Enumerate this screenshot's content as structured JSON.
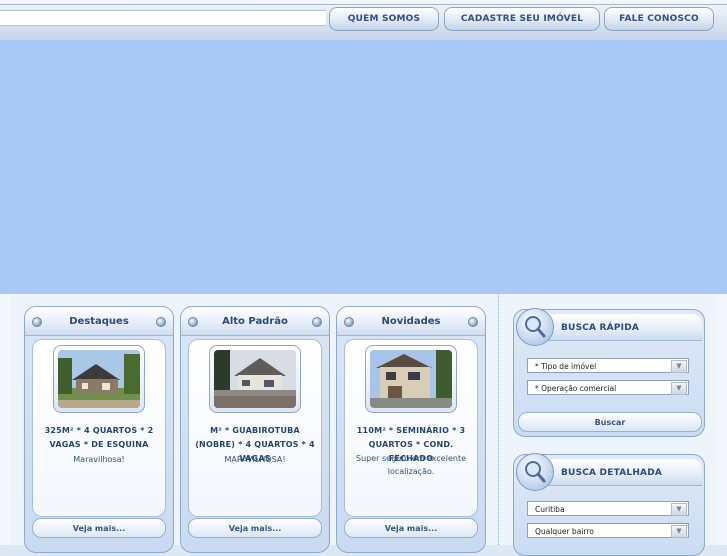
{
  "nav": {
    "about": "QUEM SOMOS",
    "register": "CADASTRE SEU IMÓVEL",
    "contact": "FALE CONOSCO"
  },
  "cards": [
    {
      "heading": "Destaques",
      "title": "325M² * 4 QUARTOS * 2 VAGAS * DE ESQUINA",
      "desc": "Maravilhosa!",
      "more": "Veja mais..."
    },
    {
      "heading": "Alto Padrão",
      "title": "M² * GUABIROTUBA (NOBRE) * 4 QUARTOS * 4 VAGAS",
      "desc": "MARAVILHOSA!",
      "more": "Veja mais..."
    },
    {
      "heading": "Novidades",
      "title": "110M² * SEMINÁRIO * 3 QUARTOS * COND. FECHADO",
      "desc": "Super seguro em excelente localização.",
      "more": "Veja mais..."
    }
  ],
  "quick_search": {
    "title": "BUSCA RÁPIDA",
    "property_type": "* Tipo de imóvel",
    "operation": "* Operação comercial",
    "button": "Buscar"
  },
  "detailed_search": {
    "title": "BUSCA DETALHADA",
    "city": "Curitiba",
    "neighborhood": "Qualquer bairro"
  },
  "colors": {
    "banner": "#a8c8f5",
    "accent_text": "#2c4a7e"
  }
}
